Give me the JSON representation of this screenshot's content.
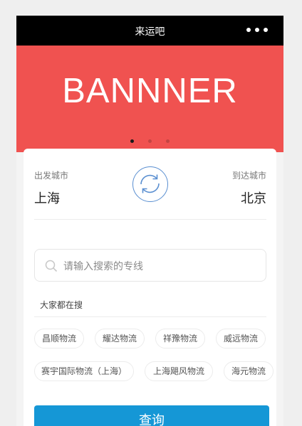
{
  "app": {
    "title": "来运吧"
  },
  "banner": {
    "text": "BANNNER",
    "carousel_pages": 3,
    "active_page": 1
  },
  "route": {
    "from_label": "出发城市",
    "from_city": "上海",
    "to_label": "到达城市",
    "to_city": "北京"
  },
  "search": {
    "placeholder": "请输入搜索的专线"
  },
  "hot": {
    "heading": "大家都在搜",
    "tags": [
      "昌顺物流",
      "耀达物流",
      "祥豫物流",
      "威远物流",
      "赛宇国际物流（上海）",
      "上海飓风物流",
      "海元物流"
    ]
  },
  "actions": {
    "query_label": "查询"
  },
  "colors": {
    "banner": "#f05250",
    "primary": "#1597d6",
    "swap_icon": "#5a8fd1"
  },
  "icons": {
    "more": "more-dots-icon",
    "swap": "swap-cities-icon",
    "search": "search-icon"
  }
}
